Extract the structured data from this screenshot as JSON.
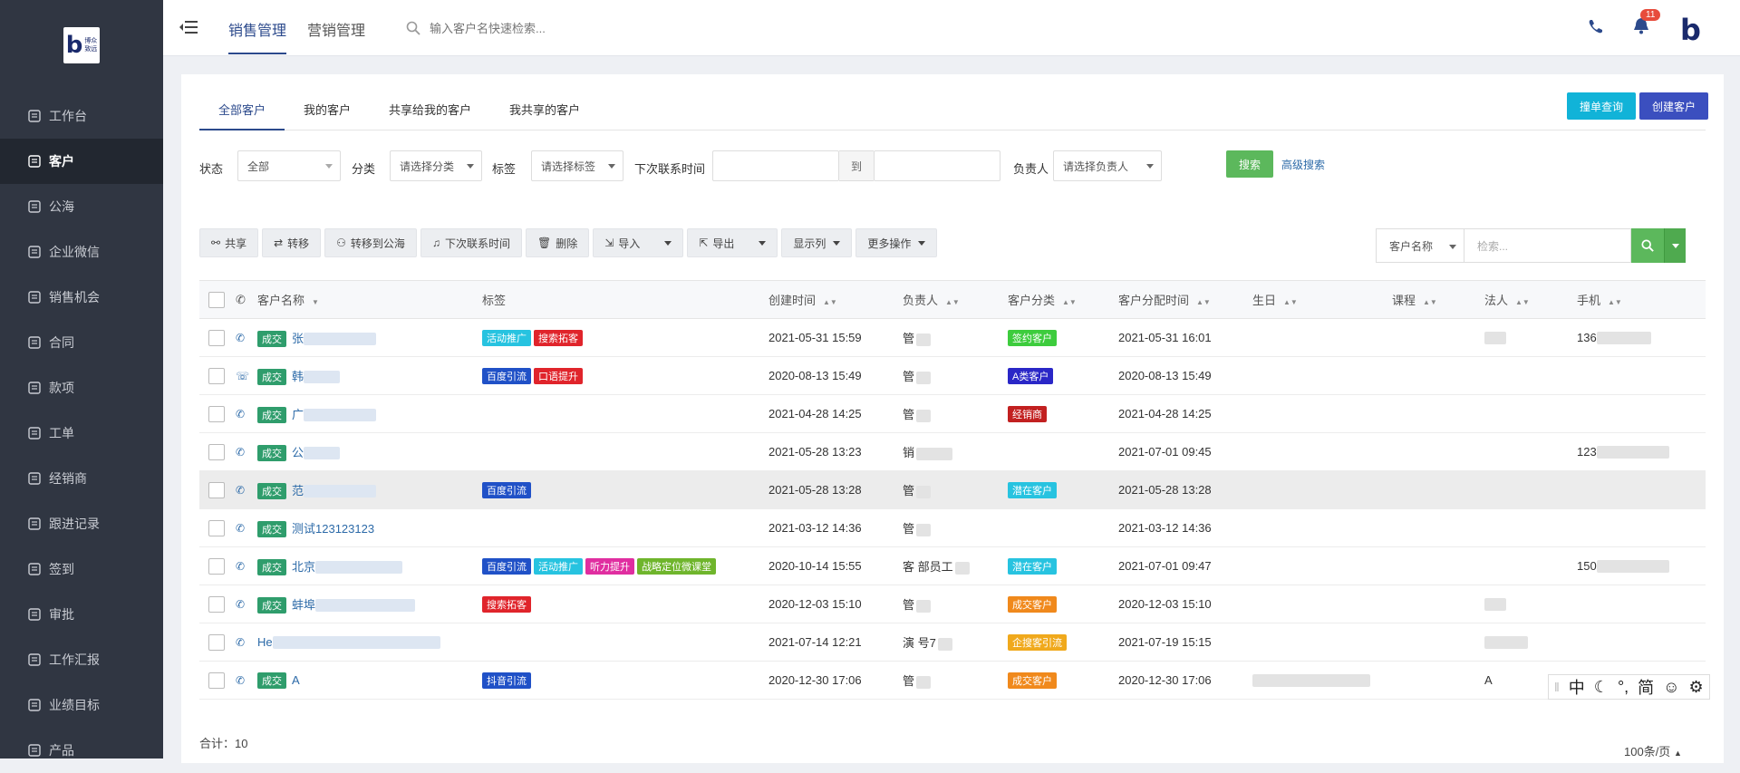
{
  "brand": {
    "logo_text": "博众致远"
  },
  "sidebar": {
    "items": [
      {
        "label": "工作台",
        "icon": "monitor-icon"
      },
      {
        "label": "客户",
        "icon": "address-book-icon",
        "active": true
      },
      {
        "label": "公海",
        "icon": "basket-icon"
      },
      {
        "label": "企业微信",
        "icon": "chat-icon"
      },
      {
        "label": "销售机会",
        "icon": "money-bag-icon"
      },
      {
        "label": "合同",
        "icon": "contract-icon"
      },
      {
        "label": "款项",
        "icon": "payment-icon"
      },
      {
        "label": "工单",
        "icon": "ticket-icon"
      },
      {
        "label": "经销商",
        "icon": "store-icon"
      },
      {
        "label": "跟进记录",
        "icon": "edit-icon"
      },
      {
        "label": "签到",
        "icon": "location-icon"
      },
      {
        "label": "审批",
        "icon": "stamp-icon"
      },
      {
        "label": "工作汇报",
        "icon": "report-icon"
      },
      {
        "label": "业绩目标",
        "icon": "target-icon"
      },
      {
        "label": "产品",
        "icon": "grid-icon"
      }
    ]
  },
  "header": {
    "tabs": [
      "销售管理",
      "营销管理"
    ],
    "search_placeholder": "输入客户名快速检索...",
    "notification_count": "11"
  },
  "page": {
    "tabs": [
      "全部客户",
      "我的客户",
      "共享给我的客户",
      "我共享的客户"
    ],
    "btn_query": "撞单查询",
    "btn_create": "创建客户"
  },
  "filters": {
    "status_label": "状态",
    "status_value": "全部",
    "category_label": "分类",
    "category_placeholder": "请选择分类",
    "tag_label": "标签",
    "tag_placeholder": "请选择标签",
    "next_contact_label": "下次联系时间",
    "date_to": "到",
    "owner_label": "负责人",
    "owner_placeholder": "请选择负责人",
    "search_btn": "搜索",
    "advanced_link": "高级搜索"
  },
  "toolbar": {
    "share": "共享",
    "transfer": "转移",
    "to_pool": "转移到公海",
    "next_contact": "下次联系时间",
    "delete": "删除",
    "import": "导入",
    "export": "导出",
    "columns": "显示列",
    "more": "更多操作"
  },
  "table_search": {
    "field": "客户名称",
    "placeholder": "检索..."
  },
  "table": {
    "headers": [
      "客户名称",
      "标签",
      "创建时间",
      "负责人",
      "客户分类",
      "客户分配时间",
      "生日",
      "课程",
      "法人",
      "手机"
    ],
    "deal_label": "成交",
    "rows": [
      {
        "deal": true,
        "name": "张",
        "tags": [
          {
            "t": "活动推广",
            "c": "#27c3e0"
          },
          {
            "t": "搜索拓客",
            "c": "#e0242b"
          }
        ],
        "created": "2021-05-31 15:59",
        "owner": "管",
        "cat": {
          "t": "签约客户",
          "c": "#3dcc3d"
        },
        "assigned": "2021-05-31 16:01",
        "legal": "",
        "phone": "136"
      },
      {
        "deal": true,
        "name": "韩",
        "tags": [
          {
            "t": "百度引流",
            "c": "#2051c7"
          },
          {
            "t": "口语提升",
            "c": "#e0242b"
          }
        ],
        "created": "2020-08-13 15:49",
        "owner": "管",
        "cat": {
          "t": "A类客户",
          "c": "#2a27c7"
        },
        "assigned": "2020-08-13 15:49",
        "legal": "",
        "phone": ""
      },
      {
        "deal": true,
        "name": "广",
        "tags": [],
        "created": "2021-04-28 14:25",
        "owner": "管",
        "cat": {
          "t": "经销商",
          "c": "#c22020"
        },
        "assigned": "2021-04-28 14:25",
        "legal": "",
        "phone": ""
      },
      {
        "deal": true,
        "name": "公",
        "tags": [],
        "created": "2021-05-28 13:23",
        "owner": "销",
        "cat": null,
        "assigned": "2021-07-01 09:45",
        "legal": "",
        "phone": "123"
      },
      {
        "deal": true,
        "name": "范",
        "tags": [
          {
            "t": "百度引流",
            "c": "#2051c7"
          }
        ],
        "created": "2021-05-28 13:28",
        "owner": "管",
        "cat": {
          "t": "潜在客户",
          "c": "#27c3e0"
        },
        "assigned": "2021-05-28 13:28",
        "legal": "",
        "phone": "",
        "highlight": true
      },
      {
        "deal": true,
        "name": "测试123123123",
        "tags": [],
        "created": "2021-03-12 14:36",
        "owner": "管",
        "cat": null,
        "assigned": "2021-03-12 14:36",
        "legal": "",
        "phone": ""
      },
      {
        "deal": true,
        "name": "北京",
        "tags": [
          {
            "t": "百度引流",
            "c": "#2051c7"
          },
          {
            "t": "活动推广",
            "c": "#27c3e0"
          },
          {
            "t": "听力提升",
            "c": "#e02ea0"
          },
          {
            "t": "战略定位微课堂",
            "c": "#6fb52c"
          }
        ],
        "created": "2020-10-14 15:55",
        "owner": "客 部员工",
        "cat": {
          "t": "潜在客户",
          "c": "#27c3e0"
        },
        "assigned": "2021-07-01 09:47",
        "legal": "",
        "phone": "150"
      },
      {
        "deal": true,
        "name": "蚌埠",
        "tags": [
          {
            "t": "搜索拓客",
            "c": "#e0242b"
          }
        ],
        "created": "2020-12-03 15:10",
        "owner": "管",
        "cat": {
          "t": "成交客户",
          "c": "#f0891c"
        },
        "assigned": "2020-12-03 15:10",
        "legal": "",
        "phone": ""
      },
      {
        "deal": false,
        "name": "He",
        "tags": [],
        "created": "2021-07-14 12:21",
        "owner": "演 号7",
        "cat": {
          "t": "企搜客引流",
          "c": "#f0a91c"
        },
        "assigned": "2021-07-19 15:15",
        "legal": "",
        "phone": ""
      },
      {
        "deal": true,
        "name": "A",
        "tags": [
          {
            "t": "抖音引流",
            "c": "#2051c7"
          }
        ],
        "created": "2020-12-30 17:06",
        "owner": "管",
        "cat": {
          "t": "成交客户",
          "c": "#f0891c"
        },
        "assigned": "2020-12-30 17:06",
        "legal": "A",
        "phone": ""
      }
    ]
  },
  "footer": {
    "total": "合计：10",
    "page_size": "100条/页"
  },
  "ime": {
    "items": [
      "中",
      "☾",
      "°,",
      "简",
      "☺",
      "⚙"
    ]
  }
}
